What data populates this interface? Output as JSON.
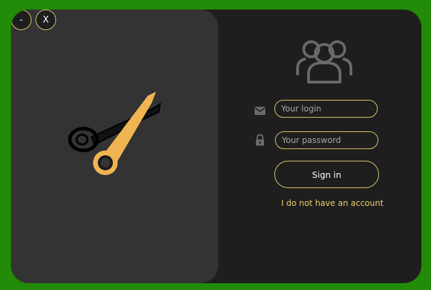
{
  "window": {
    "minimize_label": "-",
    "close_label": "X"
  },
  "logo": {
    "icon": "scissors-icon"
  },
  "header": {
    "icon": "users-icon"
  },
  "form": {
    "login_placeholder": "Your login",
    "login_value": "",
    "login_icon": "mail-icon",
    "password_placeholder": "Your password",
    "password_value": "",
    "password_icon": "lock-icon",
    "signin_label": "Sign in",
    "no_account_label": "I do not have an account"
  },
  "colors": {
    "background": "#228B07",
    "panel_dark": "#1e1e1e",
    "panel_left": "#333333",
    "accent": "#e0c870",
    "icon_gray": "#6a6a6a"
  }
}
